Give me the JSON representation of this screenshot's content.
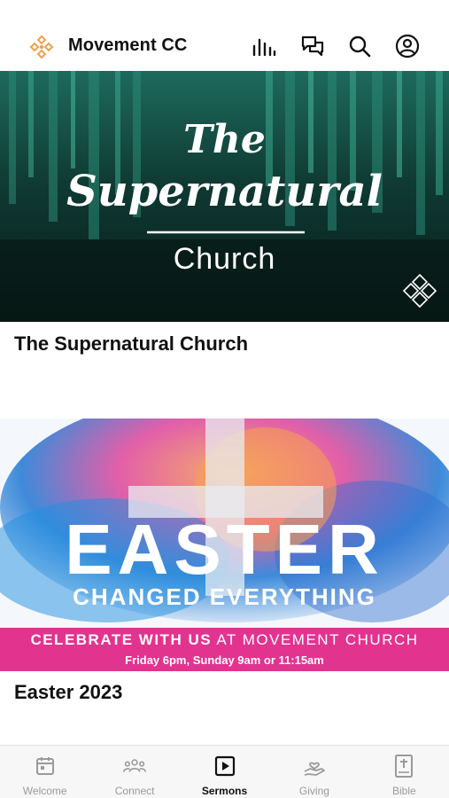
{
  "header": {
    "title": "Movement CC",
    "logo_icon": "movement-logo-icon",
    "actions": [
      "audio-bars-icon",
      "chat-bubbles-icon",
      "search-icon",
      "account-icon"
    ],
    "accent_color": "#f0a050"
  },
  "sermons": [
    {
      "title": "The Supernatural Church",
      "banner": {
        "headline_line1": "The",
        "headline_line2": "Supernatural",
        "headline_line3": "Church",
        "bg_color": "#0c2a26",
        "accent_color": "#2a8a76"
      }
    },
    {
      "title": "Easter 2023",
      "banner": {
        "headline": "EASTER",
        "subheadline": "CHANGED EVERYTHING",
        "strip_text_bold": "CELEBRATE WITH US",
        "strip_text_regular": "AT MOVEMENT CHURCH",
        "strip_times": "Friday 6pm, Sunday 9am or 11:15am",
        "strip_color": "#e2338f"
      }
    }
  ],
  "tabbar": {
    "active": "Sermons",
    "tabs": [
      {
        "label": "Welcome",
        "icon": "calendar-icon"
      },
      {
        "label": "Connect",
        "icon": "people-icon"
      },
      {
        "label": "Sermons",
        "icon": "play-square-icon"
      },
      {
        "label": "Giving",
        "icon": "heart-hand-icon"
      },
      {
        "label": "Bible",
        "icon": "bible-icon"
      }
    ]
  }
}
